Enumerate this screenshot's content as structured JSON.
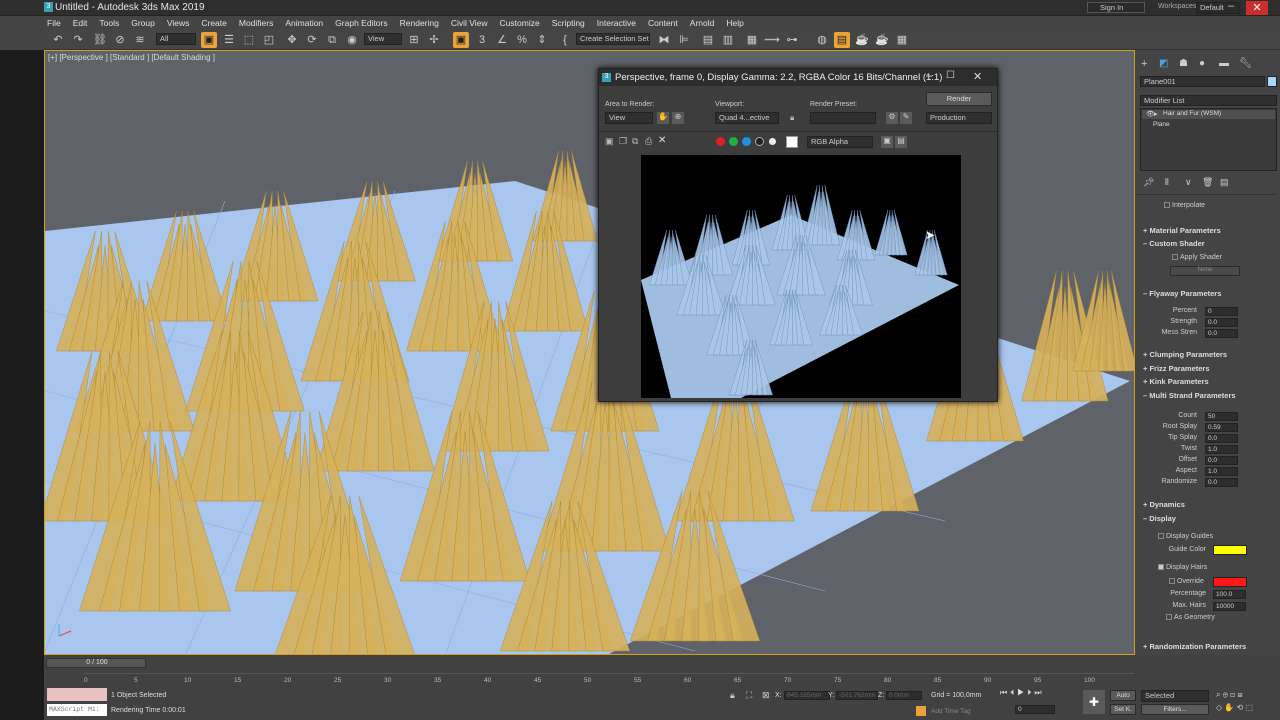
{
  "window": {
    "title": "Untitled - Autodesk 3ds Max 2019",
    "sign_in": "Sign In",
    "workspaces_label": "Workspaces:",
    "workspace_value": "Default"
  },
  "menu": [
    "File",
    "Edit",
    "Tools",
    "Group",
    "Views",
    "Create",
    "Modifiers",
    "Animation",
    "Graph Editors",
    "Rendering",
    "Civil View",
    "Customize",
    "Scripting",
    "Interactive",
    "Content",
    "Arnold",
    "Help"
  ],
  "toolbar": {
    "filter": "All",
    "view": "View",
    "selection_set": "Create Selection Set"
  },
  "viewport": {
    "label": "[+] [Perspective ] [Standard ] [Default Shading ]"
  },
  "render_window": {
    "title": "Perspective, frame 0, Display Gamma: 2.2, RGBA Color 16 Bits/Channel (1:1)",
    "area_label": "Area to Render:",
    "area_value": "View",
    "viewport_label": "Viewport:",
    "viewport_value": "Quad 4...ective",
    "preset_label": "Render Preset:",
    "preset_value": "",
    "render_button": "Render",
    "mode_value": "Production",
    "channel_value": "RGB Alpha"
  },
  "command_panel": {
    "object_name": "Plane001",
    "modifier_list": "Modifier List",
    "stack": [
      "Hair and Fur (WSM)",
      "Plane"
    ],
    "interpolate": "Interpolate",
    "material_parameters": "Material Parameters",
    "custom_shader": "Custom Shader",
    "apply_shader": "Apply Shader",
    "none": "None",
    "flyaway": {
      "title": "Flyaway Parameters",
      "rows": [
        {
          "label": "Percent",
          "value": "0"
        },
        {
          "label": "Strength",
          "value": "0.0"
        },
        {
          "label": "Mess Stren",
          "value": "0.0"
        }
      ]
    },
    "clumping": "Clumping Parameters",
    "frizz": "Frizz Parameters",
    "kink": "Kink Parameters",
    "multi_strand": {
      "title": "Multi Strand Parameters",
      "rows": [
        {
          "label": "Count",
          "value": "50"
        },
        {
          "label": "Root Splay",
          "value": "0.59"
        },
        {
          "label": "Tip Splay",
          "value": "0.0"
        },
        {
          "label": "Twist",
          "value": "1.0"
        },
        {
          "label": "Offset",
          "value": "0.0"
        },
        {
          "label": "Aspect",
          "value": "1.0"
        },
        {
          "label": "Randomize",
          "value": "0.0"
        }
      ]
    },
    "dynamics": "Dynamics",
    "display": {
      "title": "Display",
      "display_guides": "Display Guides",
      "guide_color": "Guide Color",
      "display_hairs": "Display Hairs",
      "override": "Override",
      "percentage_label": "Percentage",
      "percentage_value": "100.0",
      "max_hairs_label": "Max. Hairs",
      "max_hairs_value": "10000",
      "as_geometry": "As Geometry"
    },
    "randomization": "Randomization Parameters"
  },
  "colors": {
    "guide": "#ffff00",
    "override": "#ff1a1a",
    "accent": "#e9a33a",
    "hair": "#d8b15a",
    "plane": "#a9c6ee"
  },
  "timeline": {
    "frame": "0 / 100",
    "ticks": [
      "0",
      "5",
      "10",
      "15",
      "20",
      "25",
      "30",
      "35",
      "40",
      "45",
      "50",
      "55",
      "60",
      "65",
      "70",
      "75",
      "80",
      "85",
      "90",
      "95",
      "100"
    ]
  },
  "status": {
    "selection": "1 Object Selected",
    "render_time": "Rendering Time 0:00:01",
    "x_label": "X:",
    "x_value": "645.185mm",
    "y_label": "Y:",
    "y_value": "-501.762mm",
    "z_label": "Z:",
    "z_value": "0.0mm",
    "grid": "Grid = 100,0mm",
    "add_time_tag": "Add Time Tag",
    "auto": "Auto",
    "selected": "Selected",
    "set_k": "Set K.",
    "filters": "Filters...",
    "maxscript": "MAXScript Mi:",
    "frame_value": "0"
  }
}
